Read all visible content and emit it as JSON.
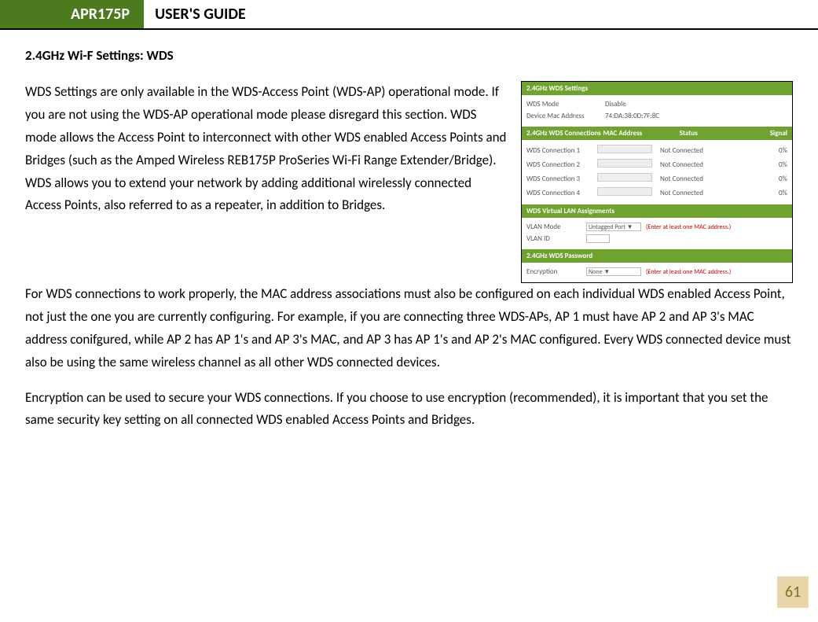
{
  "header": {
    "badge": "APR175P",
    "title": "USER'S GUIDE"
  },
  "section_heading": "2.4GHz Wi-F Settings: WDS",
  "paragraphs": {
    "p1": "WDS Settings are only available in the WDS-Access Point (WDS-AP) operational mode. If you are not using the WDS-AP operational mode please disregard this section. WDS mode allows the Access Point to interconnect with other WDS enabled Access Points and Bridges (such as the Amped Wireless REB175P ProSeries Wi-Fi Range Extender/Bridge). WDS allows you to extend your network by adding additional wirelessly connected Access Points, also referred to as a repeater, in addition to Bridges.",
    "p2": "For WDS connections to work properly, the MAC address associations must also be configured on each individual WDS enabled Access Point, not just the one you are currently configuring.  For example, if you are connecting three WDS-APs, AP 1 must have AP 2 and AP 3's MAC address conifgured, while AP 2 has AP 1's and AP 3's MAC, and AP 3 has AP 1's and AP 2's MAC configured.  Every WDS connected device must also be using the same wireless channel as all other WDS connected devices.",
    "p3": "Encryption can be used to secure your WDS connections.  If you choose to use encryption (recommended), it is important that you set the same security key setting on all connected WDS enabled Access Points and Bridges."
  },
  "screenshot": {
    "settings": {
      "title": "2.4GHz WDS Settings",
      "mode_label": "WDS Mode",
      "mode_value": "Disable",
      "mac_label": "Device Mac Address",
      "mac_value": "74:DA:38:0D:7F:8C"
    },
    "connections": {
      "title": "2.4GHz WDS Connections",
      "col_mac": "MAC Address",
      "col_status": "Status",
      "col_signal": "Signal",
      "rows": [
        {
          "name": "WDS Connection 1",
          "status": "Not Connected",
          "signal": "0%"
        },
        {
          "name": "WDS Connection 2",
          "status": "Not Connected",
          "signal": "0%"
        },
        {
          "name": "WDS Connection 3",
          "status": "Not Connected",
          "signal": "0%"
        },
        {
          "name": "WDS Connection 4",
          "status": "Not Connected",
          "signal": "0%"
        }
      ]
    },
    "vlan": {
      "title": "WDS Virtual LAN Assignments",
      "mode_label": "VLAN Mode",
      "mode_value": "Untagged Port ▼",
      "id_label": "VLAN ID",
      "hint": "(Enter at least one MAC address.)"
    },
    "password": {
      "title": "2.4GHz WDS Password",
      "enc_label": "Encryption",
      "enc_value": "None ▼",
      "hint": "(Enter at least one MAC address.)"
    }
  },
  "page_number": "61"
}
